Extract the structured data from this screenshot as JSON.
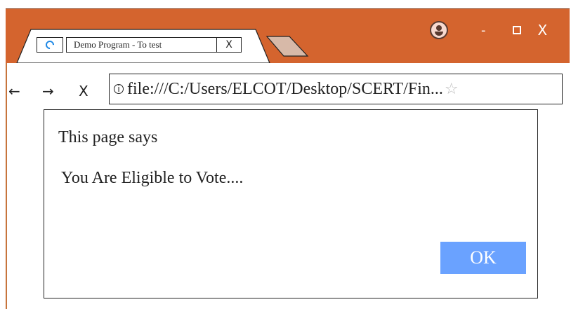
{
  "window": {
    "tab_title": "Demo Program - To test",
    "tab_close": "X",
    "minimize": "-",
    "close": "X"
  },
  "nav": {
    "back": "←",
    "forward": "→",
    "stop": "X",
    "url": "file:///C:/Users/ELCOT/Desktop/SCERT/Fin...",
    "info_symbol": "i",
    "star": "☆"
  },
  "dialog": {
    "header": "This page says",
    "message": "You Are Eligible to Vote....",
    "ok_label": "OK"
  },
  "colors": {
    "titlebar": "#d4642e",
    "ok_button": "#6aa2ff"
  }
}
